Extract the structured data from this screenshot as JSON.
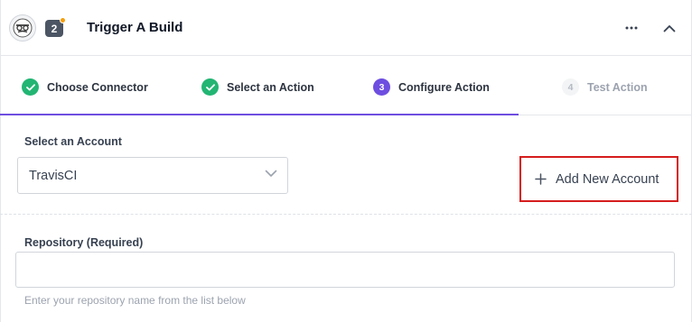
{
  "header": {
    "title": "Trigger A Build",
    "step_number": "2",
    "logo_icon": "travisci-mascot-icon",
    "more_icon": "more-horizontal-icon",
    "collapse_icon": "chevron-up-icon"
  },
  "stepper": {
    "steps": [
      {
        "label": "Choose Connector",
        "state": "done"
      },
      {
        "label": "Select an Action",
        "state": "done"
      },
      {
        "label": "Configure Action",
        "state": "active",
        "number": "3"
      },
      {
        "label": "Test Action",
        "state": "inactive",
        "number": "4"
      }
    ],
    "progress_color": "#6d4ee0"
  },
  "account": {
    "label": "Select an Account",
    "selected": "TravisCI",
    "add_button_label": "Add New Account",
    "add_icon": "plus-icon"
  },
  "repository": {
    "label": "Repository",
    "required_tag": "(Required)",
    "value": "",
    "hint": "Enter your repository name from the list below"
  },
  "colors": {
    "check_green": "#22b573",
    "accent_purple": "#6d4ee0",
    "highlight_red": "#d51d1d",
    "badge_gray": "#4b5563",
    "badge_dot": "#f59e0b"
  }
}
